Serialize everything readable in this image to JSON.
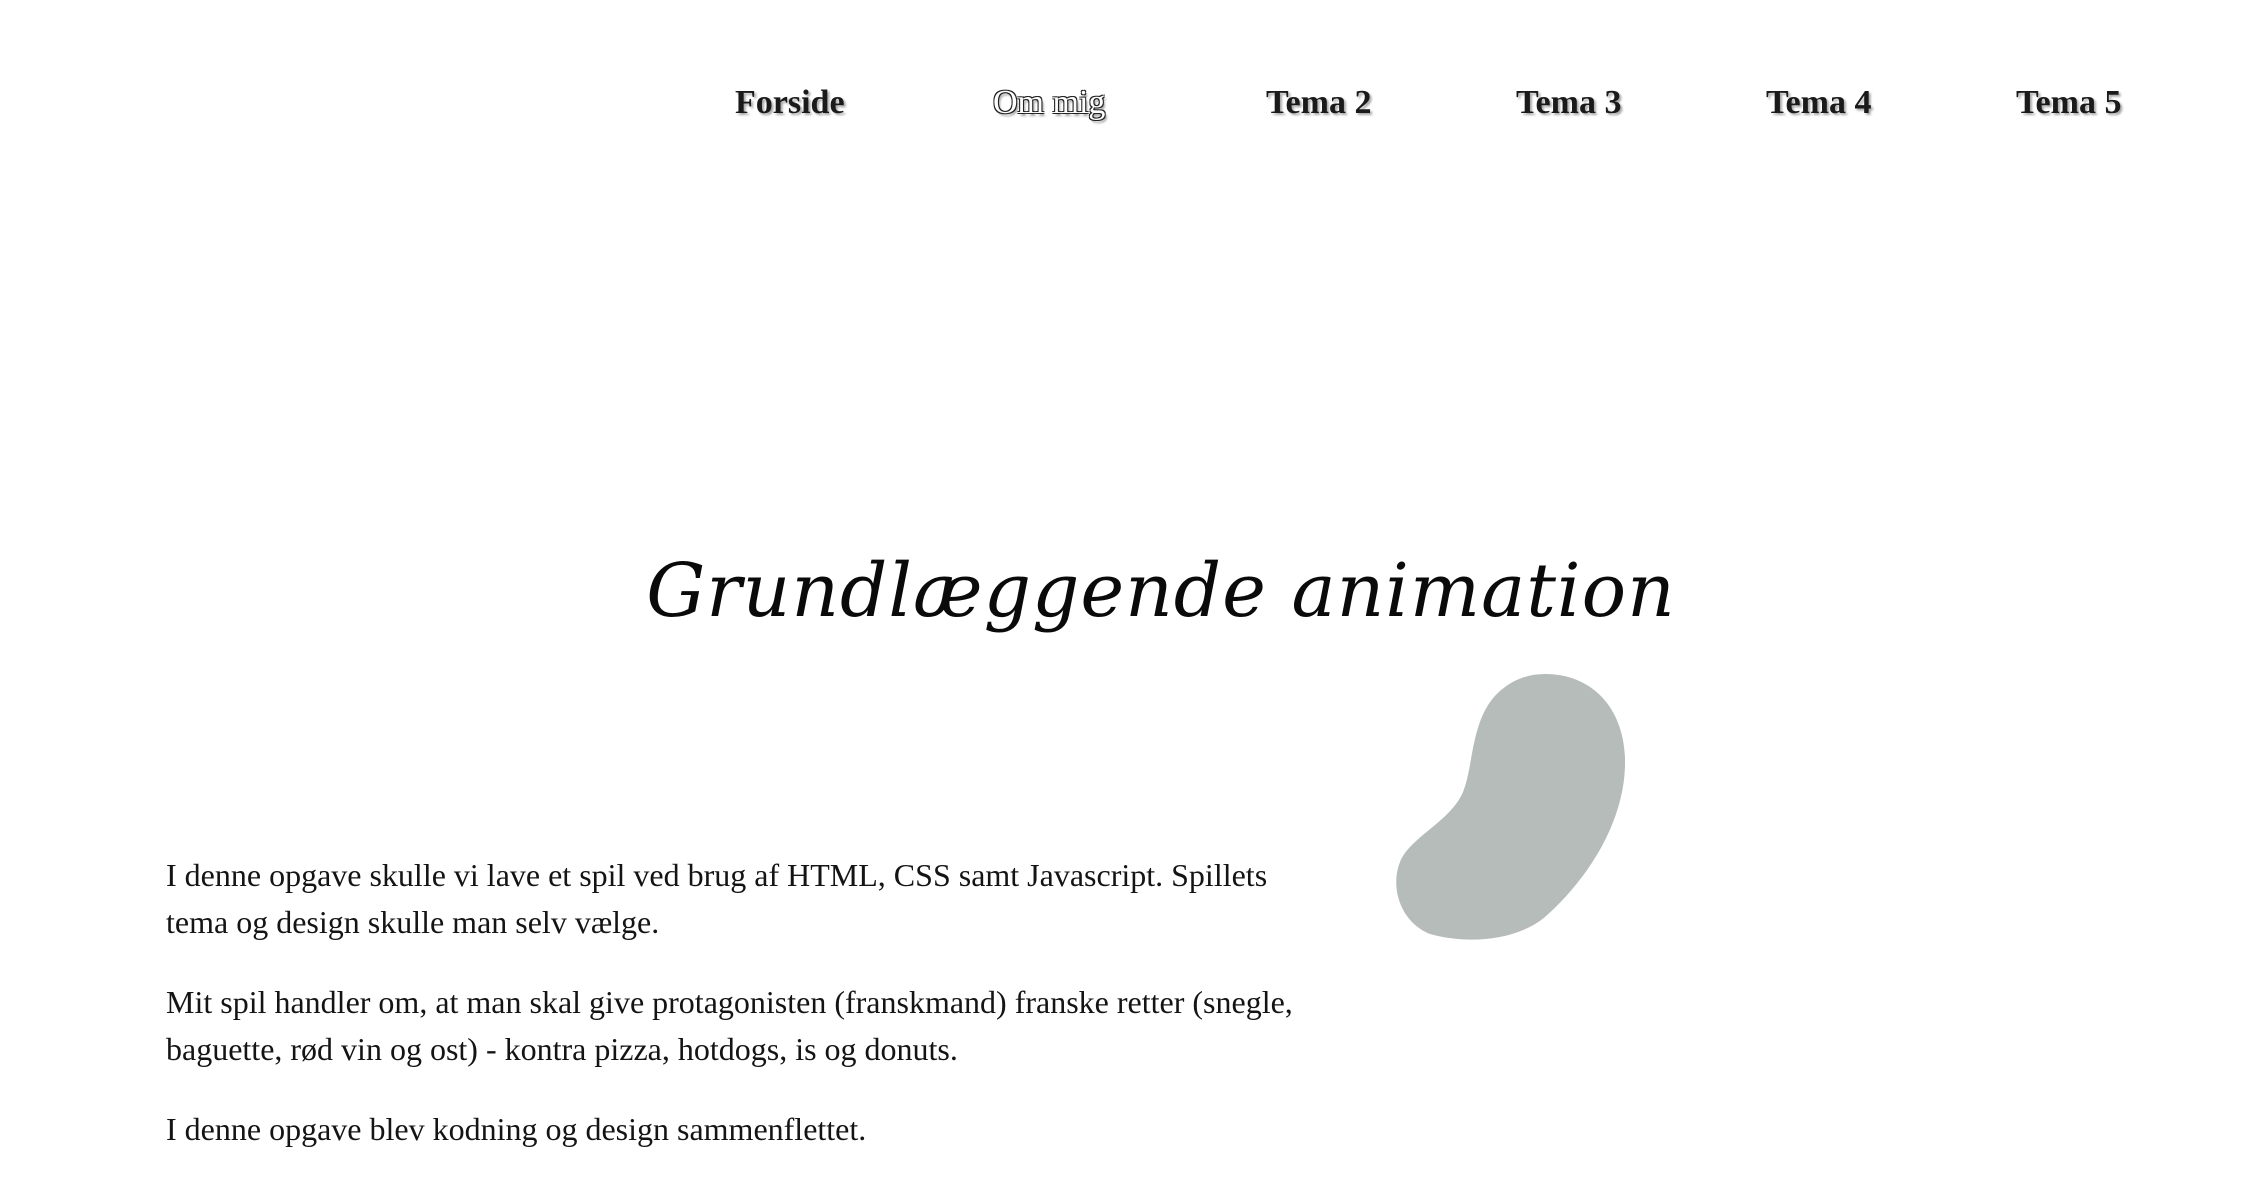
{
  "nav": {
    "items": [
      {
        "label": "Forside",
        "active": false
      },
      {
        "label": "Om mig",
        "active": true
      },
      {
        "label": "Tema 2",
        "active": false
      },
      {
        "label": "Tema 3",
        "active": false
      },
      {
        "label": "Tema 4",
        "active": false
      },
      {
        "label": "Tema 5",
        "active": false
      }
    ]
  },
  "main": {
    "title": "Grundlæggende animation",
    "paragraphs": [
      "I denne opgave skulle vi lave et spil ved brug af HTML, CSS samt Javascript. Spillets tema og design skulle man selv vælge.",
      "Mit spil handler om, at man skal give protagonisten (franskmand) franske retter (snegle, baguette, rød vin og ost) - kontra pizza, hotdogs, is og donuts.",
      "I denne opgave blev kodning og design sammenflettet."
    ]
  },
  "decoration": {
    "blob_icon": "blob-shape",
    "blob_color": "#b5bcb9"
  },
  "colors": {
    "background": "#ffffff",
    "text": "#141414"
  }
}
